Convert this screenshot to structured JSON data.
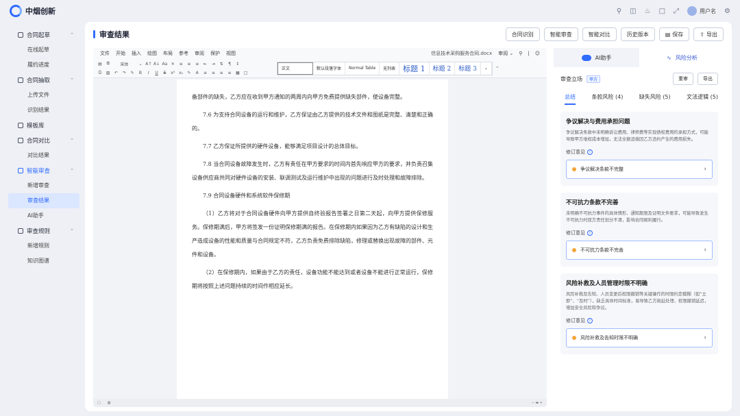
{
  "app": {
    "brand": "中烟创新",
    "user_name": "用户名"
  },
  "sidebar": {
    "groups": [
      {
        "label": "合同起草",
        "icon": "grid-icon",
        "items": [
          "在线起草",
          "履约进度"
        ]
      },
      {
        "label": "合同抽取",
        "icon": "extract-icon",
        "items": [
          "上传文件",
          "识别结果"
        ]
      },
      {
        "label": "模板库",
        "icon": "template-icon",
        "items": []
      },
      {
        "label": "合同对比",
        "icon": "compare-icon",
        "items": [
          "对比结果"
        ]
      },
      {
        "label": "智能审查",
        "icon": "review-icon",
        "items": [
          "新增审查",
          "审查结果",
          "AI助手"
        ]
      },
      {
        "label": "审查规则",
        "icon": "rules-icon",
        "items": [
          "新增规则",
          "知识图谱"
        ]
      }
    ],
    "active_group": "智能审查",
    "active_item": "审查结果"
  },
  "header": {
    "title": "审查结果",
    "buttons": [
      "合同识别",
      "智能审查",
      "智能对比",
      "历史版本",
      "保存",
      "导出"
    ]
  },
  "editor": {
    "menu": [
      "文件",
      "开始",
      "插入",
      "绘图",
      "布局",
      "参考",
      "审阅",
      "保护",
      "视图"
    ],
    "doc_name": "信息技术采购服务合同.docx",
    "mode": "审阅",
    "font_name": "宋体",
    "styles": [
      "正文",
      "默认段落字体",
      "Normal Table",
      "无列表",
      "标题 1",
      "标题 2",
      "标题 3"
    ],
    "paragraphs": [
      {
        "text": "备部件的缺失，乙方应在收到甲方通知的两周内向甲方免费提供缺失部件，使设备完整。",
        "indent": false
      },
      {
        "text": "7.6 为支持合同设备的运行和维护，乙方保证由乙方提供的技术文件和图纸是完整、清楚和正确的。",
        "indent": true
      },
      {
        "text": "7.7 乙方保证所提供的硬件设备，能够满足项目设计的总体目标。",
        "indent": true
      },
      {
        "text": "7.8 当合同设备故障发生时，乙方有责任在甲方要求的时间内首先响应甲方的要求，并负责召集设备供应商共同对硬件设备的安装、联调测试及运行维护中出现的问题进行及时处理和故障排除。",
        "indent": true
      },
      {
        "text": "7.9 合同设备硬件和系统软件保修期",
        "indent": true
      },
      {
        "text": "（1）乙方将对于合同设备硬件向甲方提供自终验报告签署之日第二天起，向甲方提供保修服务。保修期满后，甲方将签发一份证明保修期满的报告。在保修期内如果因为乙方有缺陷的设计和生产造成设备的性能和质量与合同规定不符，乙方负责免费排除缺陷，修理或替换出现故障的部件、元件和设备。",
        "indent": true
      },
      {
        "text": "（2）在保修期内，如果由于乙方的责任，设备功能不能达到或者设备不能进行正常运行，保修期将按照上述问题持续的时间作相应延长。",
        "indent": true
      }
    ]
  },
  "panel": {
    "tabs": [
      "AI助手",
      "风险分析"
    ],
    "stance_label": "审查立场",
    "stance_value": "甲方",
    "actions": [
      "重审",
      "导出"
    ],
    "subtabs": [
      {
        "label": "总结",
        "count": ""
      },
      {
        "label": "条款风险",
        "count": "(4)"
      },
      {
        "label": "缺失风险",
        "count": "(5)"
      },
      {
        "label": "文法逻辑",
        "count": "(5)"
      }
    ],
    "opinion_label": "修订意见",
    "cards": [
      {
        "title": "争议解决与费用承担问题",
        "desc": "争议解决条款中未明确诉讼费用、律师费等实现债权费用的承担方式，可能导致甲方维权成本增加，无法全额追偿因乙方违约产生的费用损失。",
        "issue": "争议解决条款不完整"
      },
      {
        "title": "不可抗力条款不完善",
        "desc": "未明确不可抗力事件的具体情形、通知期限及证明文件要求，可能导致发生不可抗力时双方责任划分不清，影响合同顺利履行。",
        "issue": "不可抗力条款不完善"
      },
      {
        "title": "风险补救及人员管理时限不明确",
        "desc": "风险补救及告知、人员变更后权限撤销等关键操作的时限约定模糊（如“立即”、“及时”），缺乏具体时间标准，易导致乙方拖延处理、权限撤销延迟，增加安全风险和争议。",
        "issue": "风险补救及告知时限不明确"
      }
    ]
  }
}
